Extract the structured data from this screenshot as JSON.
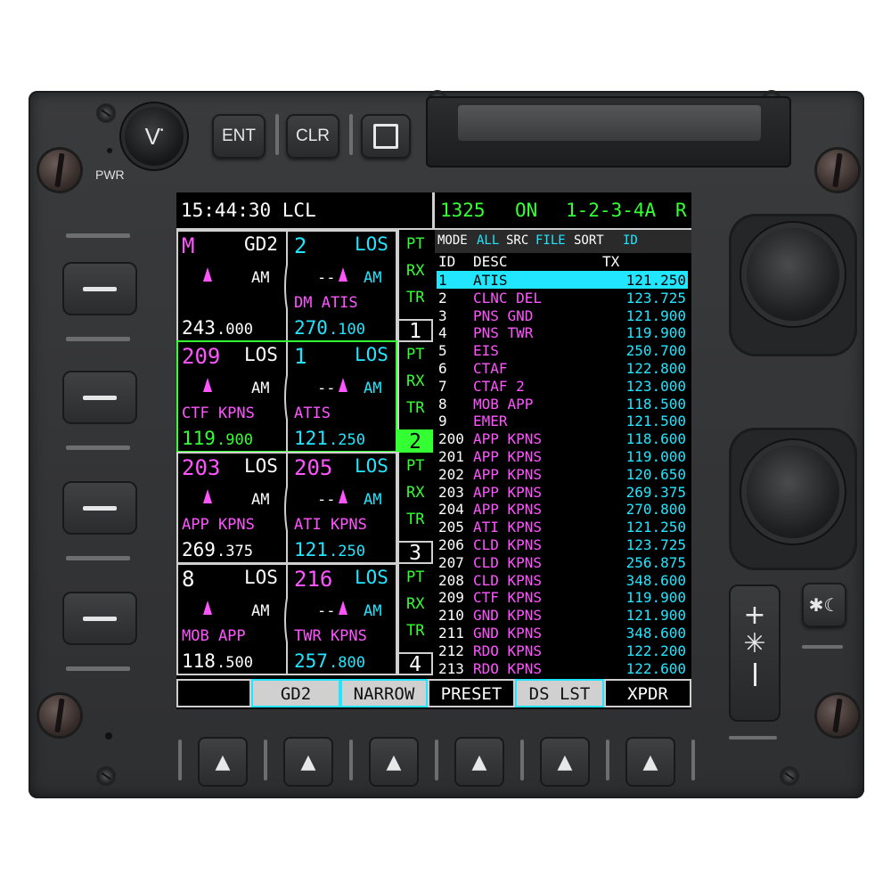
{
  "panel": {
    "pwr_label": "PWR",
    "volume_label": "V",
    "ent_label": "ENT",
    "clr_label": "CLR",
    "brightness_plus": "+",
    "brightness_minus": "−",
    "line_select_keys": 4,
    "bottom_softkey_symbol": "▲"
  },
  "status": {
    "clock": "15:44:30 LCL",
    "xpdr_code": "1325",
    "xpdr_state": "ON",
    "modes": "1-2-3-4A",
    "r_flag": "R"
  },
  "radios": [
    {
      "slot": "1",
      "left": {
        "title": "M",
        "tag": "GD2",
        "mod": "AM",
        "desc": "",
        "freq_main": "243",
        "freq_dec": ".000",
        "title_color": "#ff55ff",
        "freq_color": "#ffffff"
      },
      "right": {
        "title": "2",
        "tag": "LOS",
        "dash": "--",
        "mod": "AM",
        "desc": "DM ATIS",
        "freq_main": "270",
        "freq_dec": ".100"
      },
      "side": [
        "PT",
        "RX",
        "TR"
      ],
      "selected": false
    },
    {
      "slot": "2",
      "left": {
        "title": "209",
        "tag": "LOS",
        "mod": "AM",
        "desc": "CTF KPNS",
        "freq_main": "119",
        "freq_dec": ".900",
        "title_color": "#ff55ff",
        "freq_color": "#33ff33"
      },
      "right": {
        "title": "1",
        "tag": "LOS",
        "dash": "--",
        "mod": "AM",
        "desc": "ATIS",
        "freq_main": "121",
        "freq_dec": ".250"
      },
      "side": [
        "PT",
        "RX",
        "TR"
      ],
      "selected": true
    },
    {
      "slot": "3",
      "left": {
        "title": "203",
        "tag": "LOS",
        "mod": "AM",
        "desc": "APP KPNS",
        "freq_main": "269",
        "freq_dec": ".375",
        "title_color": "#ff55ff",
        "freq_color": "#ffffff"
      },
      "right": {
        "title": "205",
        "tag": "LOS",
        "dash": "--",
        "mod": "AM",
        "desc": "ATI KPNS",
        "freq_main": "121",
        "freq_dec": ".250"
      },
      "side": [
        "PT",
        "RX",
        "TR"
      ],
      "selected": false
    },
    {
      "slot": "4",
      "left": {
        "title": "8",
        "tag": "LOS",
        "mod": "AM",
        "desc": "MOB APP",
        "freq_main": "118",
        "freq_dec": ".500",
        "title_color": "#ffffff",
        "freq_color": "#ffffff"
      },
      "right": {
        "title": "216",
        "tag": "LOS",
        "dash": "--",
        "mod": "AM",
        "desc": "TWR KPNS",
        "freq_main": "257",
        "freq_dec": ".800"
      },
      "side": [
        "PT",
        "RX",
        "TR"
      ],
      "selected": false
    }
  ],
  "preset_header": {
    "mode": "MODE",
    "all": "ALL",
    "src": "SRC",
    "file": "FILE",
    "sort": "SORT",
    "id": "ID",
    "col_id": "ID",
    "col_desc": "DESC",
    "col_tx": "TX"
  },
  "presets": [
    {
      "id": "1",
      "desc": "ATIS",
      "tx": "121.250",
      "highlight": true
    },
    {
      "id": "2",
      "desc": "CLNC DEL",
      "tx": "123.725"
    },
    {
      "id": "3",
      "desc": "PNS GND",
      "tx": "121.900"
    },
    {
      "id": "4",
      "desc": "PNS TWR",
      "tx": "119.900"
    },
    {
      "id": "5",
      "desc": "EIS",
      "tx": "250.700"
    },
    {
      "id": "6",
      "desc": "CTAF",
      "tx": "122.800"
    },
    {
      "id": "7",
      "desc": "CTAF 2",
      "tx": "123.000"
    },
    {
      "id": "8",
      "desc": "MOB APP",
      "tx": "118.500"
    },
    {
      "id": "9",
      "desc": "EMER",
      "tx": "121.500"
    },
    {
      "id": "200",
      "desc": "APP KPNS",
      "tx": "118.600"
    },
    {
      "id": "201",
      "desc": "APP KPNS",
      "tx": "119.000"
    },
    {
      "id": "202",
      "desc": "APP KPNS",
      "tx": "120.650"
    },
    {
      "id": "203",
      "desc": "APP KPNS",
      "tx": "269.375"
    },
    {
      "id": "204",
      "desc": "APP KPNS",
      "tx": "270.800"
    },
    {
      "id": "205",
      "desc": "ATI KPNS",
      "tx": "121.250"
    },
    {
      "id": "206",
      "desc": "CLD KPNS",
      "tx": "123.725"
    },
    {
      "id": "207",
      "desc": "CLD KPNS",
      "tx": "256.875"
    },
    {
      "id": "208",
      "desc": "CLD KPNS",
      "tx": "348.600"
    },
    {
      "id": "209",
      "desc": "CTF KPNS",
      "tx": "119.900"
    },
    {
      "id": "210",
      "desc": "GND KPNS",
      "tx": "121.900"
    },
    {
      "id": "211",
      "desc": "GND KPNS",
      "tx": "348.600"
    },
    {
      "id": "212",
      "desc": "RDO KPNS",
      "tx": "122.200"
    },
    {
      "id": "213",
      "desc": "RDO KPNS",
      "tx": "122.600"
    }
  ],
  "softkeys": [
    {
      "label": "",
      "style": "plain"
    },
    {
      "label": "GD2",
      "style": "grey"
    },
    {
      "label": "NARROW",
      "style": "grey"
    },
    {
      "label": "PRESET",
      "style": "active"
    },
    {
      "label": "DS LST",
      "style": "grey"
    },
    {
      "label": "XPDR",
      "style": "plain"
    }
  ]
}
